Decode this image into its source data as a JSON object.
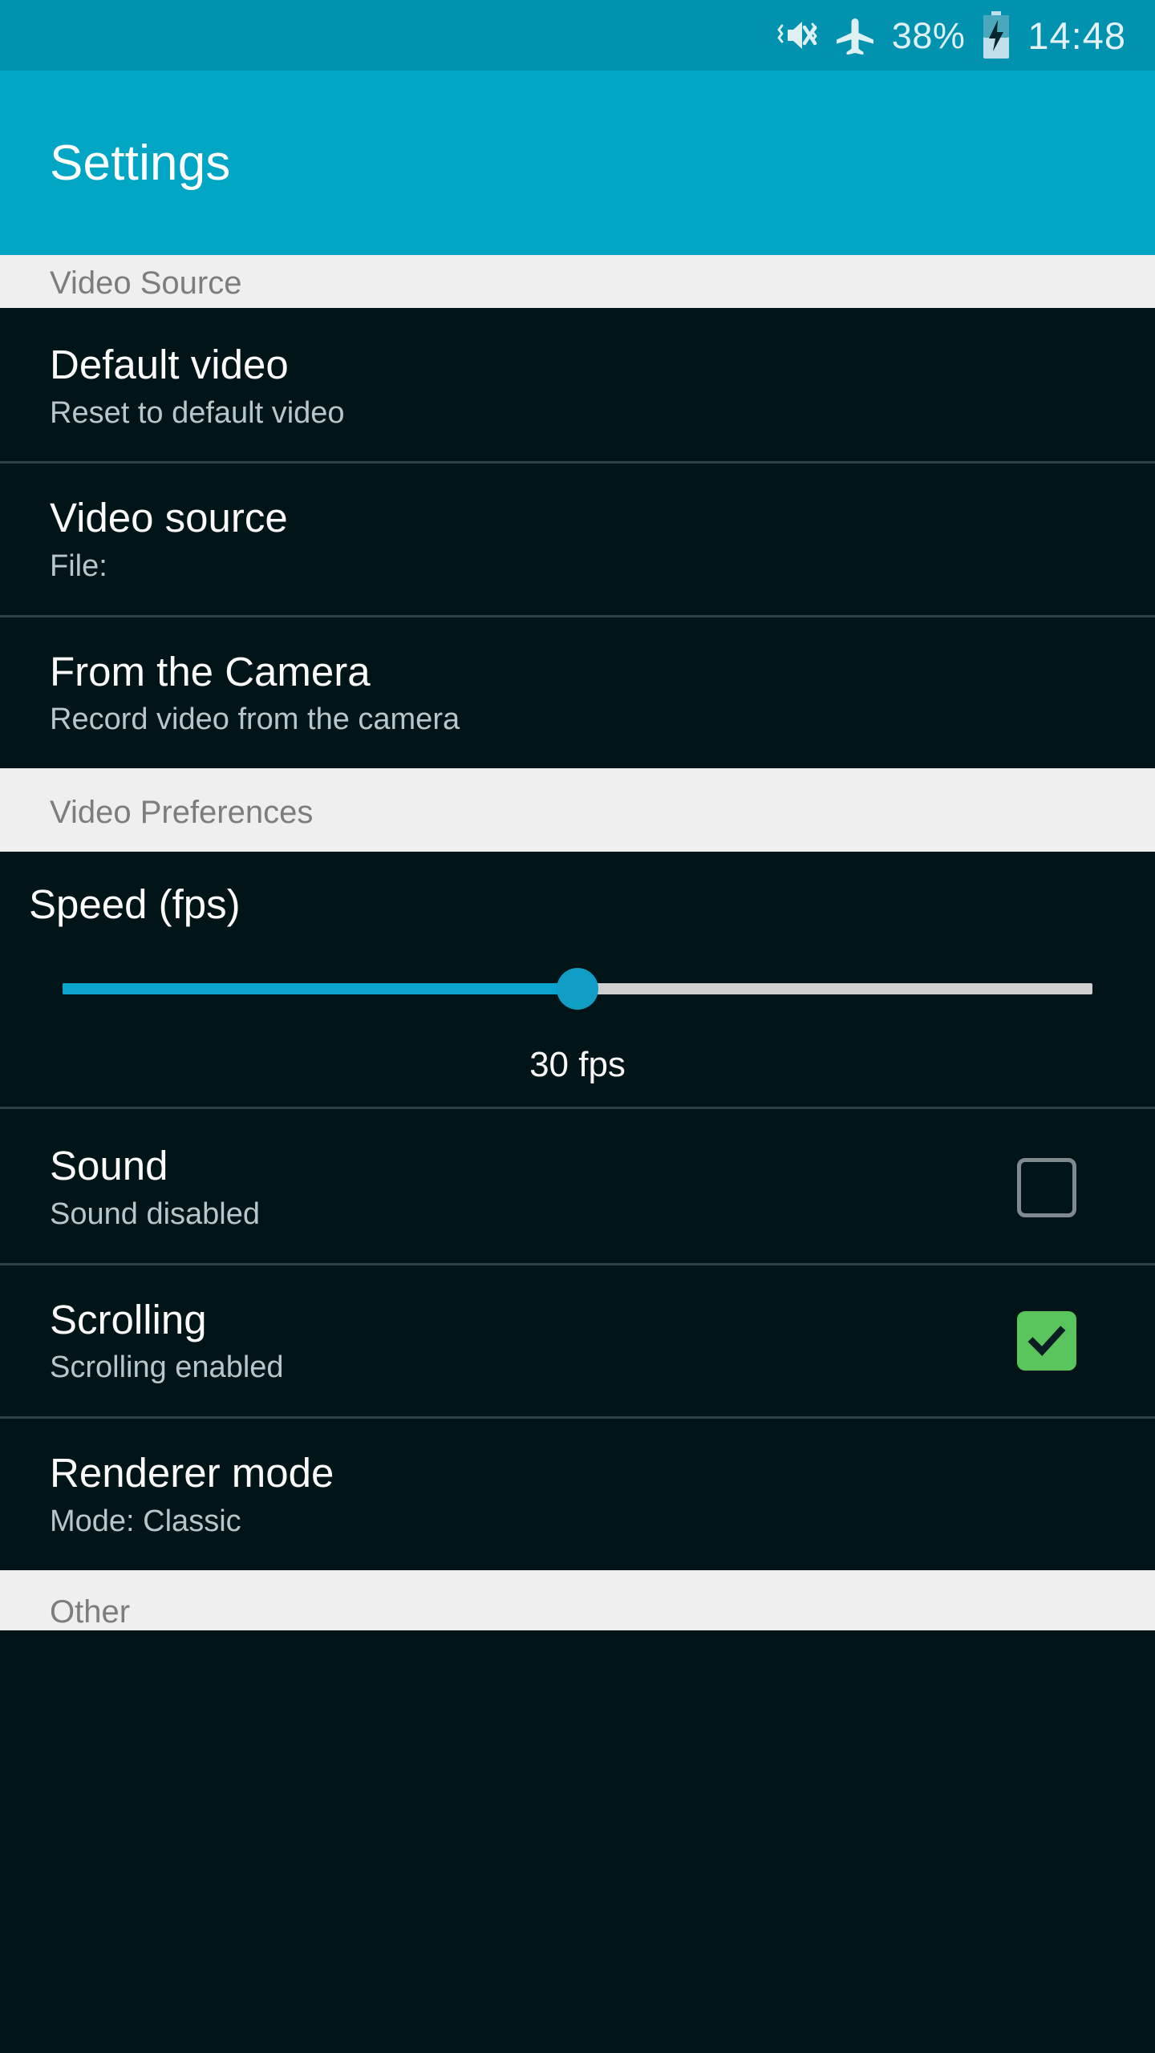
{
  "status_bar": {
    "background_color": "#0092ae",
    "icons": [
      {
        "name": "vibrate-mute-icon",
        "label": "Sound off / vibrate"
      },
      {
        "name": "airplane-mode-icon",
        "label": "Airplane mode"
      }
    ],
    "battery_percent": "38%",
    "battery_state": "charging",
    "clock": "14:48"
  },
  "action_bar": {
    "title": "Settings",
    "background_color": "#00a6c4"
  },
  "sections": [
    {
      "header": "Video Source",
      "clipped": "top",
      "items": [
        {
          "title": "Default video",
          "subtitle": "Reset to default video",
          "type": "simple"
        },
        {
          "title": "Video source",
          "subtitle": "File:",
          "type": "simple"
        },
        {
          "title": "From the Camera",
          "subtitle": "Record video from the camera",
          "type": "simple"
        }
      ]
    },
    {
      "header": "Video Preferences",
      "clipped": "none",
      "items": [
        {
          "title": "Speed (fps)",
          "type": "seekbar",
          "value_label": "30 fps",
          "value": 30,
          "percent": 50,
          "fill_color": "#0aa4cd",
          "track_color": "#cfcfcf",
          "thumb_color": "#109ec6"
        },
        {
          "title": "Sound",
          "subtitle": "Sound disabled",
          "type": "checkbox",
          "checked": false,
          "checkbox_color": "#7f8a8c"
        },
        {
          "title": "Scrolling",
          "subtitle": "Scrolling enabled",
          "type": "checkbox",
          "checked": true,
          "checkbox_color": "#5ac45d"
        },
        {
          "title": "Renderer mode",
          "subtitle": "Mode: Classic",
          "type": "simple"
        }
      ]
    },
    {
      "header": "Other",
      "clipped": "bottom",
      "items": []
    }
  ],
  "theme": {
    "accent": "#00a6c4",
    "background": "#011519",
    "section_header_bg": "#efefef",
    "section_header_text": "#7d7d7d",
    "title_text": "#fafafa",
    "subtitle_text": "#b9c6c9",
    "divider": "#2b3f45"
  }
}
